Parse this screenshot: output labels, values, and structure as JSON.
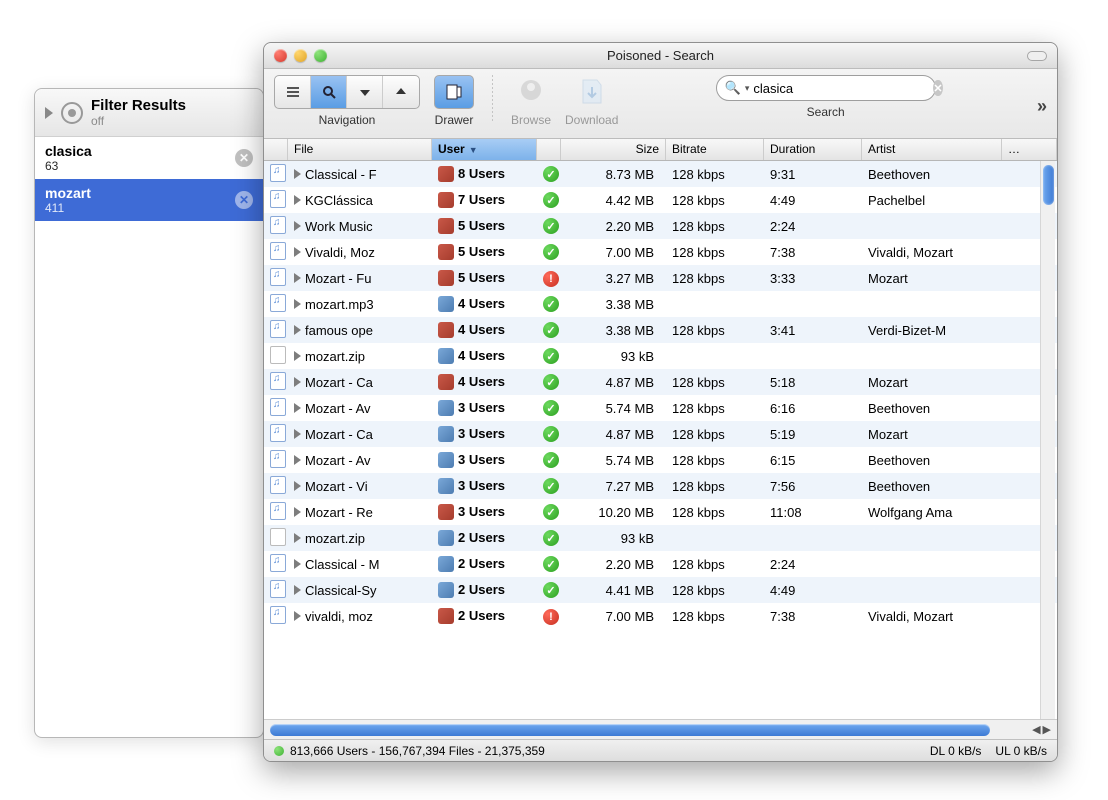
{
  "filter_panel": {
    "title": "Filter Results",
    "subtitle": "off",
    "items": [
      {
        "name": "clasica",
        "count": "63",
        "selected": false
      },
      {
        "name": "mozart",
        "count": "411",
        "selected": true
      }
    ]
  },
  "window": {
    "title": "Poisoned - Search"
  },
  "toolbar": {
    "navigation_label": "Navigation",
    "drawer_label": "Drawer",
    "browse_label": "Browse",
    "download_label": "Download",
    "search_label": "Search",
    "search_value": "clasica"
  },
  "columns": {
    "file": "File",
    "user": "User",
    "size": "Size",
    "bitrate": "Bitrate",
    "duration": "Duration",
    "artist": "Artist",
    "more": "…"
  },
  "rows": [
    {
      "icon": "music",
      "file": "Classical - F",
      "cube": "red",
      "users": "8 Users",
      "status": "ok",
      "size": "8.73 MB",
      "bitrate": "128 kbps",
      "duration": "9:31",
      "artist": "Beethoven"
    },
    {
      "icon": "music",
      "file": "KGClássica",
      "cube": "red",
      "users": "7 Users",
      "status": "ok",
      "size": "4.42 MB",
      "bitrate": "128 kbps",
      "duration": "4:49",
      "artist": "Pachelbel"
    },
    {
      "icon": "music",
      "file": "Work Music",
      "cube": "red",
      "users": "5 Users",
      "status": "ok",
      "size": "2.20 MB",
      "bitrate": "128 kbps",
      "duration": "2:24",
      "artist": ""
    },
    {
      "icon": "music",
      "file": "Vivaldi, Moz",
      "cube": "red",
      "users": "5 Users",
      "status": "ok",
      "size": "7.00 MB",
      "bitrate": "128 kbps",
      "duration": "7:38",
      "artist": "Vivaldi, Mozart"
    },
    {
      "icon": "music",
      "file": "Mozart - Fu",
      "cube": "red",
      "users": "5 Users",
      "status": "warn",
      "size": "3.27 MB",
      "bitrate": "128 kbps",
      "duration": "3:33",
      "artist": "Mozart"
    },
    {
      "icon": "music",
      "file": "mozart.mp3",
      "cube": "blue",
      "users": "4 Users",
      "status": "ok",
      "size": "3.38 MB",
      "bitrate": "",
      "duration": "",
      "artist": ""
    },
    {
      "icon": "music",
      "file": "famous ope",
      "cube": "red",
      "users": "4 Users",
      "status": "ok",
      "size": "3.38 MB",
      "bitrate": "128 kbps",
      "duration": "3:41",
      "artist": "Verdi-Bizet-M"
    },
    {
      "icon": "zip",
      "file": "mozart.zip",
      "cube": "blue",
      "users": "4 Users",
      "status": "ok",
      "size": "93 kB",
      "bitrate": "",
      "duration": "",
      "artist": ""
    },
    {
      "icon": "music",
      "file": "Mozart - Ca",
      "cube": "red",
      "users": "4 Users",
      "status": "ok",
      "size": "4.87 MB",
      "bitrate": "128 kbps",
      "duration": "5:18",
      "artist": "Mozart"
    },
    {
      "icon": "music",
      "file": "Mozart - Av",
      "cube": "blue",
      "users": "3 Users",
      "status": "ok",
      "size": "5.74 MB",
      "bitrate": "128 kbps",
      "duration": "6:16",
      "artist": "Beethoven"
    },
    {
      "icon": "music",
      "file": "Mozart - Ca",
      "cube": "blue",
      "users": "3 Users",
      "status": "ok",
      "size": "4.87 MB",
      "bitrate": "128 kbps",
      "duration": "5:19",
      "artist": "Mozart"
    },
    {
      "icon": "music",
      "file": "Mozart - Av",
      "cube": "blue",
      "users": "3 Users",
      "status": "ok",
      "size": "5.74 MB",
      "bitrate": "128 kbps",
      "duration": "6:15",
      "artist": "Beethoven"
    },
    {
      "icon": "music",
      "file": "Mozart - Vi",
      "cube": "blue",
      "users": "3 Users",
      "status": "ok",
      "size": "7.27 MB",
      "bitrate": "128 kbps",
      "duration": "7:56",
      "artist": "Beethoven"
    },
    {
      "icon": "music",
      "file": "Mozart - Re",
      "cube": "red",
      "users": "3 Users",
      "status": "ok",
      "size": "10.20 MB",
      "bitrate": "128 kbps",
      "duration": "11:08",
      "artist": "Wolfgang Ama"
    },
    {
      "icon": "zip",
      "file": "mozart.zip",
      "cube": "blue",
      "users": "2 Users",
      "status": "ok",
      "size": "93 kB",
      "bitrate": "",
      "duration": "",
      "artist": ""
    },
    {
      "icon": "music",
      "file": "Classical - M",
      "cube": "blue",
      "users": "2 Users",
      "status": "ok",
      "size": "2.20 MB",
      "bitrate": "128 kbps",
      "duration": "2:24",
      "artist": ""
    },
    {
      "icon": "music",
      "file": "Classical-Sy",
      "cube": "blue",
      "users": "2 Users",
      "status": "ok",
      "size": "4.41 MB",
      "bitrate": "128 kbps",
      "duration": "4:49",
      "artist": ""
    },
    {
      "icon": "music",
      "file": "vivaldi, moz",
      "cube": "red",
      "users": "2 Users",
      "status": "warn",
      "size": "7.00 MB",
      "bitrate": "128 kbps",
      "duration": "7:38",
      "artist": "Vivaldi, Mozart"
    }
  ],
  "status_bar": {
    "stats": "813,666 Users - 156,767,394 Files - 21,375,359",
    "dl": "DL 0 kB/s",
    "ul": "UL 0 kB/s"
  }
}
